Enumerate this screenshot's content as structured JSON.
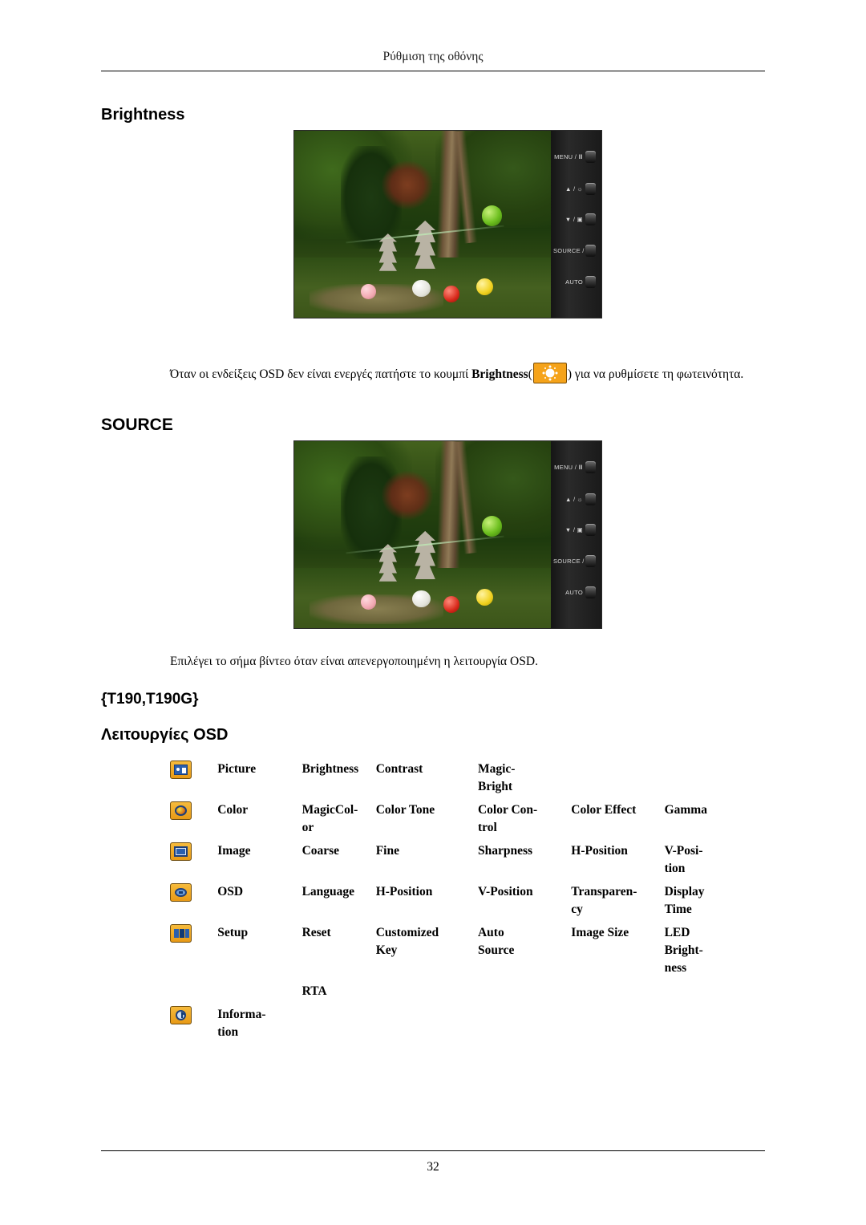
{
  "header": {
    "running_head": "Ρύθμιση της οθόνης"
  },
  "footer": {
    "page_number": "32"
  },
  "sections": {
    "brightness_heading": "Brightness",
    "source_heading": "SOURCE",
    "model_heading": "{T190,T190G}",
    "osd_heading": "Λειτουργίες OSD"
  },
  "paragraphs": {
    "brightness_text_before": "Όταν οι ενδείξεις OSD δεν είναι ενεργές πατήστε το κουμπί ",
    "brightness_bold": "Brightness",
    "brightness_text_after": ") για να ρυθμίσετε τη φωτεινότητα.",
    "brightness_paren_open": "(",
    "source_text": "Επιλέγει το σήμα βίντεο όταν είναι απενεργοποιημένη η λειτουργία OSD."
  },
  "monitor": {
    "buttons": [
      {
        "label": "MENU / Ⅲ",
        "name": "menu-button"
      },
      {
        "label": "▲ / ☼",
        "name": "up-brightness-button"
      },
      {
        "label": "▼ / ▣",
        "name": "down-magic-button"
      },
      {
        "label": "SOURCE / ↵",
        "name": "source-enter-button"
      },
      {
        "label": "AUTO",
        "name": "auto-button"
      }
    ]
  },
  "osd_table": {
    "rows": [
      {
        "icon": "picture-icon",
        "name": "Picture",
        "cells": [
          "Brightness",
          "Contrast",
          "Magic-\nBright",
          "",
          ""
        ]
      },
      {
        "icon": "color-icon",
        "name": "Color",
        "cells": [
          "MagicCol-\nor",
          "Color Tone",
          "Color  Con-\ntrol",
          "Color Effect",
          "Gamma"
        ]
      },
      {
        "icon": "image-icon",
        "name": "Image",
        "cells": [
          "Coarse",
          "Fine",
          "Sharpness",
          "H-Position",
          "V-Posi-\ntion"
        ]
      },
      {
        "icon": "osd-icon",
        "name": "OSD",
        "cells": [
          "Language",
          "H-Position",
          "V-Position",
          "Transparen-\ncy",
          "Display\nTime"
        ]
      },
      {
        "icon": "setup-icon",
        "name": "Setup",
        "cells": [
          "Reset",
          "Customized\nKey",
          "Auto\nSource",
          "Image Size",
          "LED\nBright-\nness"
        ]
      },
      {
        "icon": "",
        "name": "",
        "cells": [
          "RTA",
          "",
          "",
          "",
          ""
        ]
      },
      {
        "icon": "information-icon",
        "name": "Informa-\ntion",
        "cells": [
          "",
          "",
          "",
          "",
          ""
        ]
      }
    ]
  }
}
